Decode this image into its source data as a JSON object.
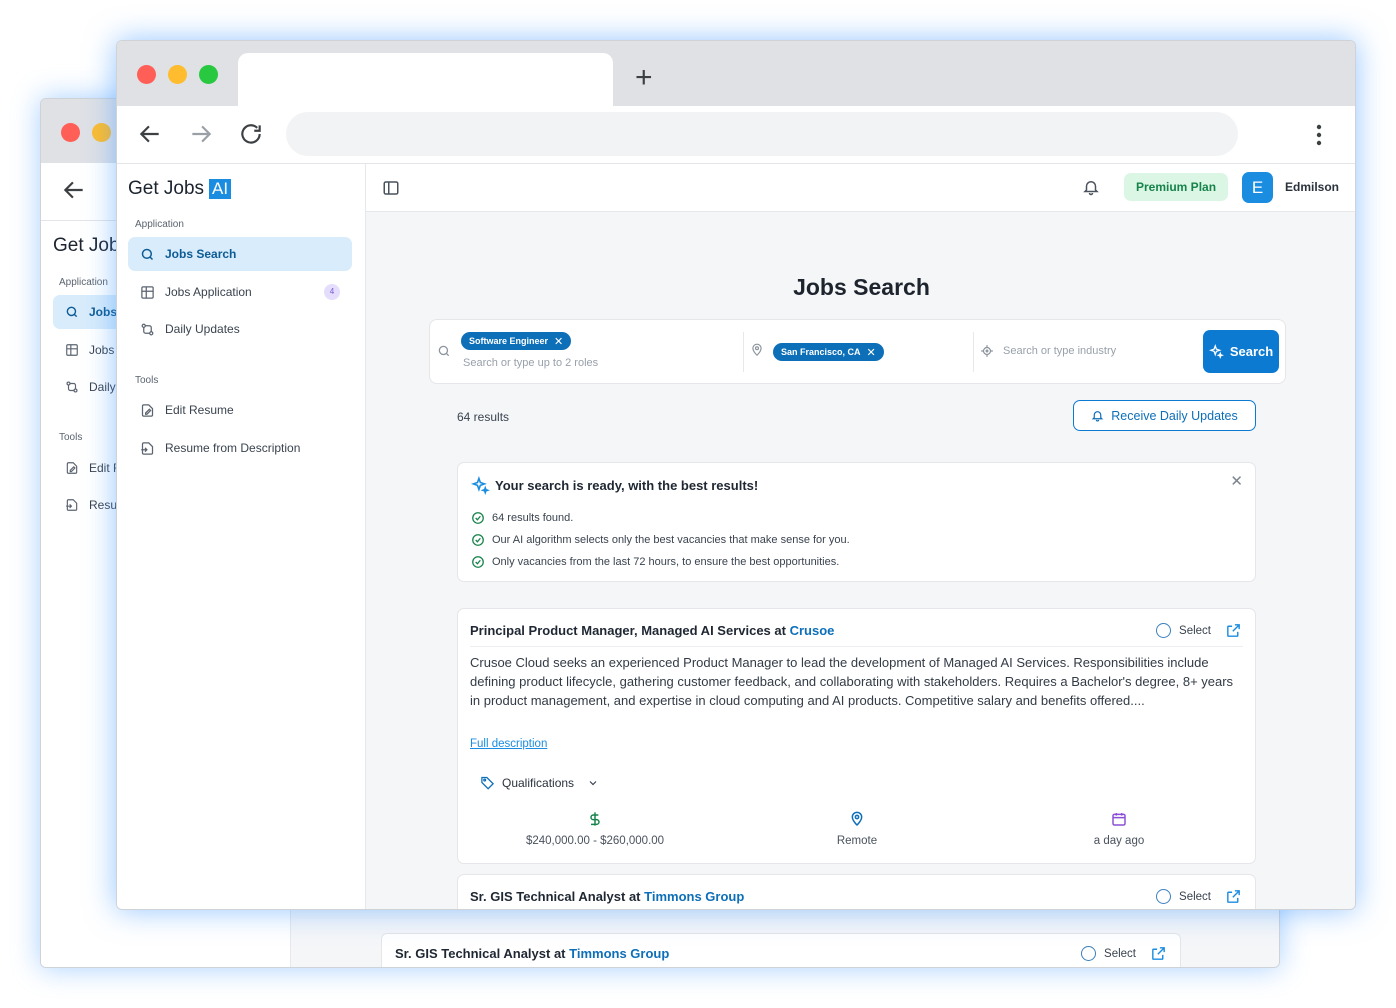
{
  "back_window": {
    "logo_text": "Get Job",
    "section_application": "Application",
    "items": [
      {
        "label": "Jobs",
        "active": true
      },
      {
        "label": "Jobs",
        "active": false
      },
      {
        "label": "Daily",
        "active": false
      }
    ],
    "section_tools": "Tools",
    "tool_items": [
      {
        "label": "Edit R"
      },
      {
        "label": "Resu"
      }
    ],
    "card_title": "Sr. GIS Technical Analyst at",
    "card_company": "Timmons Group",
    "card_select_label": "Select"
  },
  "browser": {
    "new_tab_symbol": "+"
  },
  "sidebar": {
    "logo_text": "Get Jobs",
    "logo_badge": "AI",
    "section_application": "Application",
    "items": [
      {
        "label": "Jobs Search",
        "icon": "search-icon",
        "active": true
      },
      {
        "label": "Jobs Application",
        "icon": "grid-icon",
        "active": false,
        "badge": "4"
      },
      {
        "label": "Daily Updates",
        "icon": "git-compare-icon",
        "active": false
      }
    ],
    "section_tools": "Tools",
    "tool_items": [
      {
        "label": "Edit Resume",
        "icon": "edit-file-icon"
      },
      {
        "label": "Resume from Description",
        "icon": "file-import-icon"
      }
    ]
  },
  "topbar": {
    "premium_label": "Premium Plan",
    "avatar_letter": "E",
    "username": "Edmilson"
  },
  "page": {
    "title": "Jobs Search"
  },
  "search": {
    "role_chip": "Software Engineer",
    "role_placeholder": "Search or type up to 2 roles",
    "location_chip": "San Francisco, CA",
    "industry_placeholder": "Search or type industry",
    "button_label": "Search"
  },
  "results": {
    "count_text": "64 results",
    "daily_updates_label": "Receive Daily Updates"
  },
  "info_box": {
    "title": "Your search is ready, with the best results!",
    "lines": [
      "64 results found.",
      "Our AI algorithm selects only the best vacancies that make sense for you.",
      "Only vacancies from the last 72 hours, to ensure the best opportunities."
    ]
  },
  "jobs": [
    {
      "title": "Principal Product Manager, Managed AI Services at",
      "company": "Crusoe",
      "select_label": "Select",
      "description": "Crusoe Cloud seeks an experienced Product Manager to lead the development of Managed AI Services. Responsibilities include defining product lifecycle, gathering customer feedback, and collaborating with stakeholders. Requires a Bachelor's degree, 8+ years in product management, and expertise in cloud computing and AI products. Competitive salary and benefits offered....",
      "full_description_label": "Full description",
      "qualifications_label": "Qualifications",
      "salary": "$240,000.00 - $260,000.00",
      "location": "Remote",
      "posted": "a day ago"
    },
    {
      "title": "Sr. GIS Technical Analyst at",
      "company": "Timmons Group",
      "select_label": "Select"
    }
  ],
  "colors": {
    "accent": "#0d7ad1",
    "active_bg": "#d8ecfb",
    "premium_bg": "#dcf6e6",
    "premium_text": "#16834a",
    "success": "#16834a",
    "mac_red": "#ff5f57",
    "mac_yellow": "#febc2e",
    "mac_green": "#28c840"
  }
}
